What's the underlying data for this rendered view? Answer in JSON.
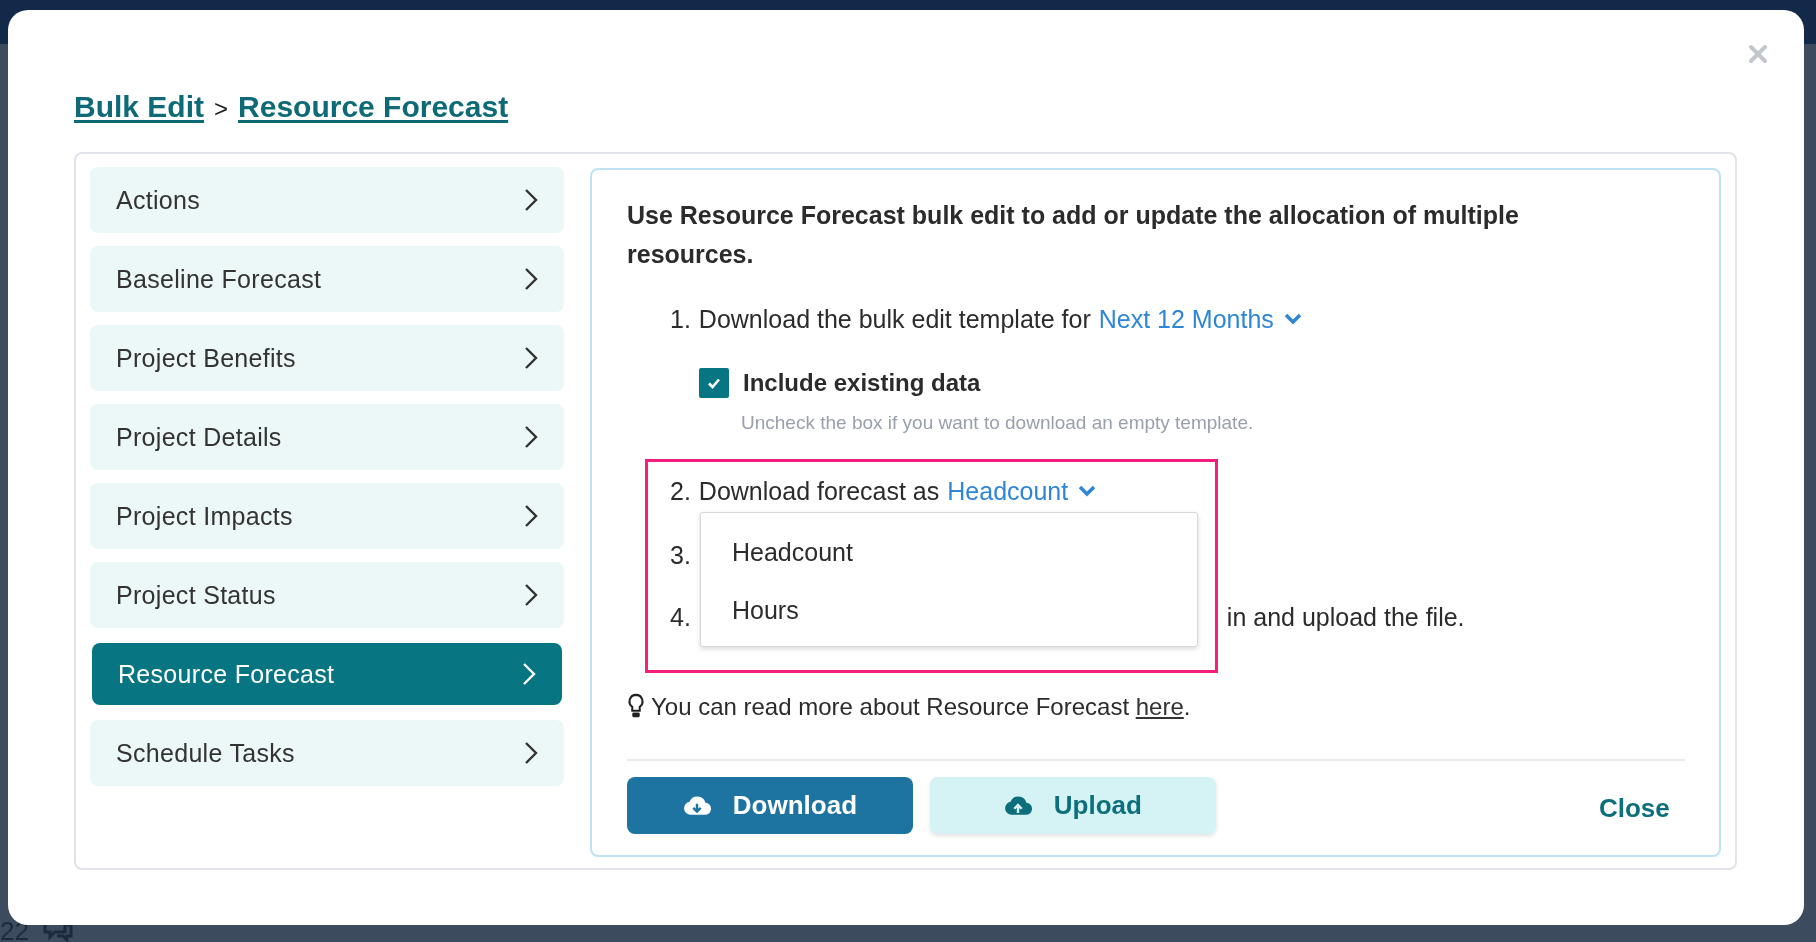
{
  "backdrop": {
    "text": "22"
  },
  "breadcrumb": {
    "items": [
      {
        "label": "Bulk Edit"
      },
      {
        "label": "Resource Forecast"
      }
    ],
    "separator": ">"
  },
  "sidebar": {
    "items": [
      {
        "label": "Actions",
        "selected": false
      },
      {
        "label": "Baseline Forecast",
        "selected": false
      },
      {
        "label": "Project Benefits",
        "selected": false
      },
      {
        "label": "Project Details",
        "selected": false
      },
      {
        "label": "Project Impacts",
        "selected": false
      },
      {
        "label": "Project Status",
        "selected": false
      },
      {
        "label": "Resource Forecast",
        "selected": true
      },
      {
        "label": "Schedule Tasks",
        "selected": false
      }
    ]
  },
  "intro": "Use Resource Forecast bulk edit to add or update the allocation of multiple resources.",
  "steps": [
    {
      "kind": "plain",
      "number": "1.",
      "text": "Download the bulk edit template for",
      "dropdown": "Next 12 Months"
    },
    {
      "kind": "plain",
      "number": "2.",
      "text": "Download forecast as",
      "dropdown": "Headcount"
    },
    {
      "kind": "plain",
      "number": "3."
    },
    {
      "kind": "covered",
      "number": "4.",
      "text": "in and upload the file."
    }
  ],
  "include_option": {
    "label": "Include existing data",
    "checked": true,
    "hint": "Uncheck the box if you want to download an empty template."
  },
  "dropdown_menu": {
    "options": [
      {
        "label": "Headcount"
      },
      {
        "label": "Hours"
      }
    ]
  },
  "info": {
    "text": "You can read more about Resource Forecast",
    "link": "here",
    "end": "."
  },
  "buttons": [
    {
      "kind": "primary",
      "label": "Download"
    },
    {
      "kind": "secondary",
      "label": "Upload"
    },
    {
      "kind": "link",
      "label": "Close"
    }
  ]
}
